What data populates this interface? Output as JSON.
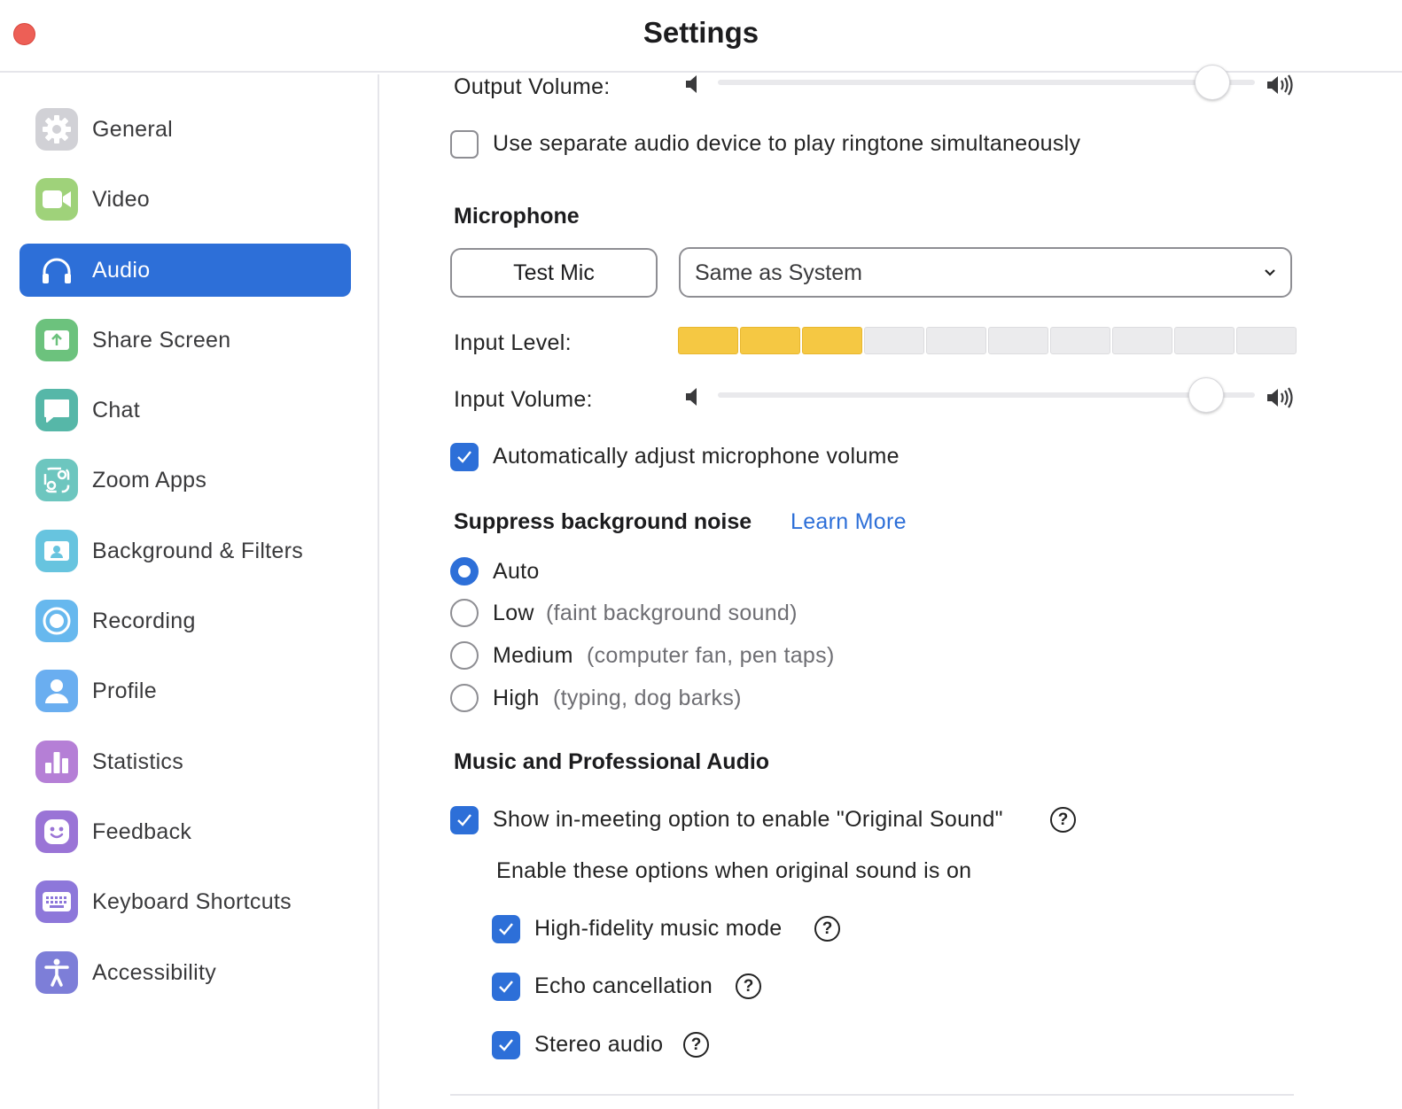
{
  "window": {
    "title": "Settings"
  },
  "sidebar": {
    "items": [
      {
        "label": "General",
        "icon": "gear-icon",
        "color": "#d1d1d6",
        "active": false
      },
      {
        "label": "Video",
        "icon": "video-camera-icon",
        "color": "#9fd27a",
        "active": false
      },
      {
        "label": "Audio",
        "icon": "headphones-icon",
        "color": "#2d6fd8",
        "active": true
      },
      {
        "label": "Share Screen",
        "icon": "share-screen-icon",
        "color": "#6cc27d",
        "active": false
      },
      {
        "label": "Chat",
        "icon": "chat-bubble-icon",
        "color": "#56b7a8",
        "active": false
      },
      {
        "label": "Zoom Apps",
        "icon": "zoom-apps-icon",
        "color": "#6dc6bf",
        "active": false
      },
      {
        "label": "Background & Filters",
        "icon": "background-icon",
        "color": "#67c4df",
        "active": false
      },
      {
        "label": "Recording",
        "icon": "record-icon",
        "color": "#67b8ee",
        "active": false
      },
      {
        "label": "Profile",
        "icon": "person-icon",
        "color": "#6aaef0",
        "active": false
      },
      {
        "label": "Statistics",
        "icon": "bar-chart-icon",
        "color": "#b57fd6",
        "active": false
      },
      {
        "label": "Feedback",
        "icon": "smiley-icon",
        "color": "#9a74d6",
        "active": false
      },
      {
        "label": "Keyboard Shortcuts",
        "icon": "keyboard-icon",
        "color": "#8d77da",
        "active": false
      },
      {
        "label": "Accessibility",
        "icon": "accessibility-icon",
        "color": "#7d7ed8",
        "active": false
      }
    ]
  },
  "speaker": {
    "output_volume_label": "Output Volume:",
    "output_volume_value": 0.92,
    "ringtone_label": "Use separate audio device to play ringtone simultaneously",
    "ringtone_checked": false
  },
  "microphone": {
    "heading": "Microphone",
    "test_button": "Test Mic",
    "device_selected": "Same as System",
    "input_level_label": "Input Level:",
    "input_level_segments_on": 3,
    "input_level_segments_total": 10,
    "input_volume_label": "Input Volume:",
    "input_volume_value": 0.91,
    "auto_adjust_label": "Automatically adjust microphone volume",
    "auto_adjust_checked": true
  },
  "noise": {
    "heading": "Suppress background noise",
    "learn_more": "Learn More",
    "options": [
      {
        "label": "Auto",
        "hint": "",
        "selected": true
      },
      {
        "label": "Low",
        "hint": "(faint background sound)",
        "selected": false
      },
      {
        "label": "Medium",
        "hint": "(computer fan, pen taps)",
        "selected": false
      },
      {
        "label": "High",
        "hint": "(typing, dog barks)",
        "selected": false
      }
    ]
  },
  "music": {
    "heading": "Music and Professional Audio",
    "original_sound_label": "Show in-meeting option to enable \"Original Sound\"",
    "original_sound_checked": true,
    "sub_heading": "Enable these options when original sound is on",
    "options": [
      {
        "label": "High-fidelity music mode",
        "checked": true
      },
      {
        "label": "Echo cancellation",
        "checked": true
      },
      {
        "label": "Stereo audio",
        "checked": true
      }
    ]
  },
  "colors": {
    "accent": "#2d6fd8",
    "level_on": "#f5c843",
    "close_button": "#ed5f56"
  }
}
